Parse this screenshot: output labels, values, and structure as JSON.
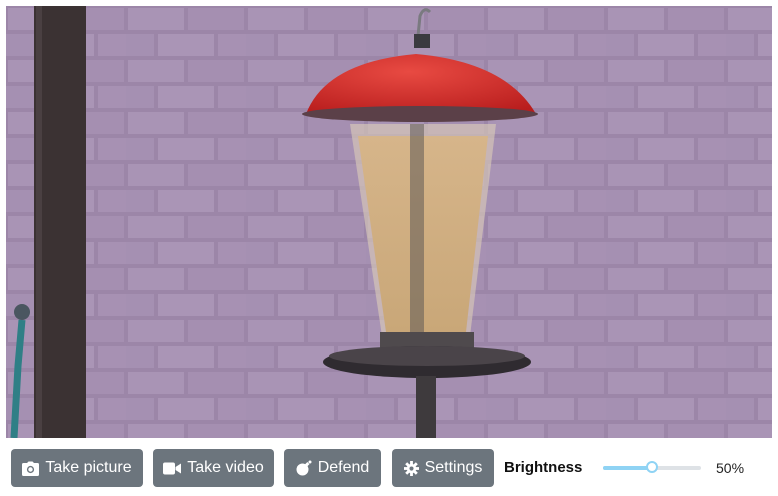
{
  "camera_feed": {
    "description_icon": "bird-feeder-camera-view"
  },
  "toolbar": {
    "take_picture": {
      "label": "Take picture",
      "icon": "camera-icon"
    },
    "take_video": {
      "label": "Take video",
      "icon": "video-camera-icon"
    },
    "defend": {
      "label": "Defend",
      "icon": "bomb-icon"
    },
    "settings": {
      "label": "Settings",
      "icon": "gear-icon"
    },
    "brightness": {
      "label": "Brightness",
      "value_text": "50%",
      "value": 0.5
    }
  },
  "colors": {
    "button_bg": "#6c757d",
    "slider_accent": "#8fd3f4",
    "feeder_roof": "#cc2222"
  }
}
